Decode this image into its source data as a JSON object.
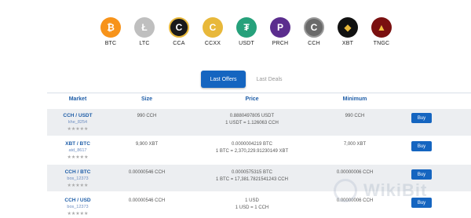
{
  "coins": [
    {
      "symbol": "BTC",
      "glyph": "₿",
      "color": "#f7931a"
    },
    {
      "symbol": "LTC",
      "glyph": "Ł",
      "color": "#bfbfbf"
    },
    {
      "symbol": "CCA",
      "glyph": "C",
      "color": "#1a1a1a"
    },
    {
      "symbol": "CCXX",
      "glyph": "C",
      "color": "#e8b83a"
    },
    {
      "symbol": "USDT",
      "glyph": "₮",
      "color": "#26a17b"
    },
    {
      "symbol": "PRCH",
      "glyph": "P",
      "color": "#5b2d8e"
    },
    {
      "symbol": "CCH",
      "glyph": "C",
      "color": "#6a6a6a"
    },
    {
      "symbol": "XBT",
      "glyph": "◆",
      "color": "#111111"
    },
    {
      "symbol": "TNGC",
      "glyph": "▲",
      "color": "#7a1010"
    }
  ],
  "tabs": {
    "active": "Last Offers",
    "inactive": "Last Deals"
  },
  "table": {
    "headers": {
      "market": "Market",
      "size": "Size",
      "price": "Price",
      "minimum": "Minimum"
    },
    "rows": [
      {
        "pair": "CCH / USDT",
        "user": "khe_8254",
        "stars": "★★★★★",
        "size": "990 CCH",
        "price": "0.88804978​05 USDT",
        "rate": "1 USDT = 1.126063 CCH",
        "minimum": "990 CCH",
        "action": "Buy"
      },
      {
        "pair": "XBT / BTC",
        "user": "atd_8617",
        "stars": "★★★★★",
        "size": "9,900 XBT",
        "price": "0.0000004219 BTC",
        "rate": "1 BTC = 2,370,229.91230149 XBT",
        "minimum": "7,000 XBT",
        "action": "Buy"
      },
      {
        "pair": "CCH / BTC",
        "user": "bos_12373",
        "stars": "★★★★★",
        "size": "0.00000546 CCH",
        "price": "0.0000575315 BTC",
        "rate": "1 BTC = 17,381.7821541243 CCH",
        "minimum": "0.00000006 CCH",
        "action": "Buy"
      },
      {
        "pair": "CCH / USD",
        "user": "bos_12373",
        "stars": "★★★★★",
        "size": "0.00000546 CCH",
        "price": "1 USD",
        "rate": "1 USD = 1 CCH",
        "minimum": "0.00000006 CCH",
        "action": "Buy"
      }
    ]
  },
  "watermark": {
    "text": "WikiBit"
  }
}
